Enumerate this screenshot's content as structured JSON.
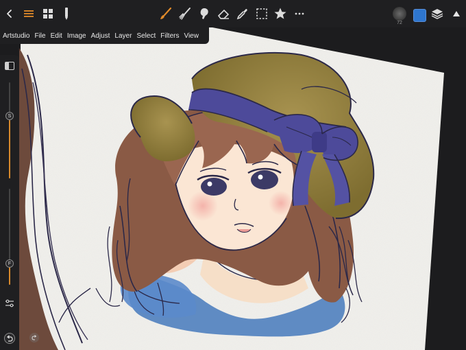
{
  "menu": [
    "Artstudio",
    "File",
    "Edit",
    "Image",
    "Adjust",
    "Layer",
    "Select",
    "Filters",
    "View"
  ],
  "brush": {
    "size_label": "72"
  },
  "colors": {
    "accent": "#e08a2a",
    "toolbar_bg": "#1f1f21",
    "current_color": "#2e76cf"
  },
  "sidebar": {
    "size_knob": "S",
    "flow_knob": "F",
    "size_value_percent": 55,
    "flow_value_percent": 30
  },
  "toolbar": {
    "icons": [
      "back-chevron-icon",
      "menu-icon",
      "gallery-grid-icon",
      "pencil-icon",
      "brush-icon",
      "smudge-icon",
      "blender-icon",
      "eraser-icon",
      "eyedropper-icon",
      "selection-icon",
      "star-icon",
      "more-icon",
      "brush-size-icon",
      "color-swatch",
      "layers-icon",
      "collapse-icon"
    ]
  }
}
